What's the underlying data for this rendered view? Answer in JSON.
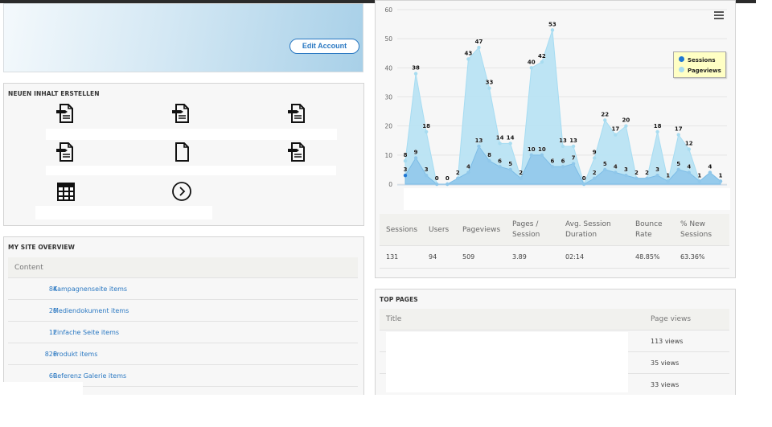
{
  "account": {
    "edit_label": "Edit Account"
  },
  "create": {
    "title": "NEUEN INHALT ERSTELLEN",
    "icons": [
      "document-edit-icon",
      "document-edit-icon",
      "document-edit-icon",
      "document-edit-icon",
      "blank-document-icon",
      "document-edit-icon",
      "table-icon",
      "arrow-circle-right-icon"
    ]
  },
  "overview": {
    "title": "MY SITE OVERVIEW",
    "header": "Content",
    "items": [
      {
        "count": "84",
        "label": "Kampagnenseite items"
      },
      {
        "count": "26",
        "label": "Mediendokument items"
      },
      {
        "count": "12",
        "label": "Einfache Seite items"
      },
      {
        "count": "826",
        "label": "Produkt items"
      },
      {
        "count": "60",
        "label": "Referenz Galerie items"
      }
    ]
  },
  "chart_data": {
    "type": "area",
    "ylim": [
      0,
      60
    ],
    "yticks": [
      "0",
      "10",
      "20",
      "30",
      "40",
      "50",
      "60"
    ],
    "grid": true,
    "legend_position": "top-right",
    "series": [
      {
        "name": "Sessions",
        "color": "#1f77d4",
        "values": [
          3,
          9,
          3,
          0,
          0,
          2,
          4,
          13,
          8,
          6,
          5,
          2,
          10,
          10,
          6,
          6,
          7,
          0,
          2,
          5,
          4,
          3,
          2,
          2,
          3,
          1,
          5,
          4,
          1,
          4,
          1
        ]
      },
      {
        "name": "Pageviews",
        "color": "#a8dcf0",
        "values": [
          8,
          38,
          18,
          0,
          0,
          2,
          43,
          47,
          33,
          14,
          14,
          2,
          40,
          42,
          53,
          13,
          13,
          0,
          9,
          22,
          17,
          20,
          2,
          2,
          18,
          1,
          17,
          12,
          1,
          4,
          1
        ]
      }
    ]
  },
  "stats": {
    "headers": [
      "Sessions",
      "Users",
      "Pageviews",
      "Pages / Session",
      "Avg. Session Duration",
      "Bounce Rate",
      "% New Sessions"
    ],
    "values": [
      "131",
      "94",
      "509",
      "3.89",
      "02:14",
      "48.85%",
      "63.36%"
    ]
  },
  "top_pages": {
    "title": "TOP PAGES",
    "col_title": "Title",
    "col_views": "Page views",
    "rows": [
      {
        "views": "113 views"
      },
      {
        "views": "35 views"
      },
      {
        "views": "33 views"
      }
    ]
  }
}
